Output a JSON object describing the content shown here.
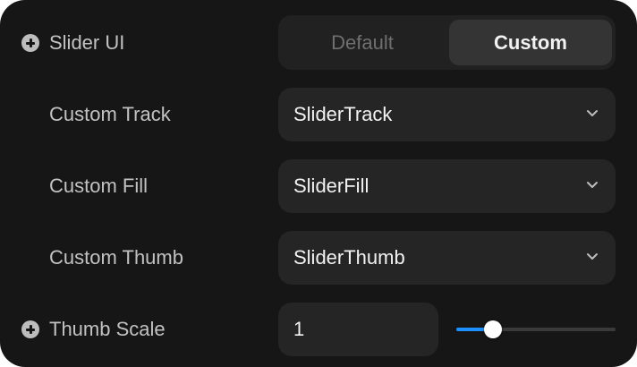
{
  "slider_ui": {
    "label": "Slider UI",
    "options": [
      "Default",
      "Custom"
    ],
    "selected": "Custom"
  },
  "custom_track": {
    "label": "Custom Track",
    "value": "SliderTrack"
  },
  "custom_fill": {
    "label": "Custom Fill",
    "value": "SliderFill"
  },
  "custom_thumb": {
    "label": "Custom Thumb",
    "value": "SliderThumb"
  },
  "thumb_scale": {
    "label": "Thumb Scale",
    "value": "1",
    "slider_fraction": 0.23
  },
  "colors": {
    "panel_bg": "#161616",
    "field_bg": "#252525",
    "accent": "#1e8fff"
  },
  "icons": [
    "plus-circle-icon",
    "chevron-down-icon"
  ]
}
